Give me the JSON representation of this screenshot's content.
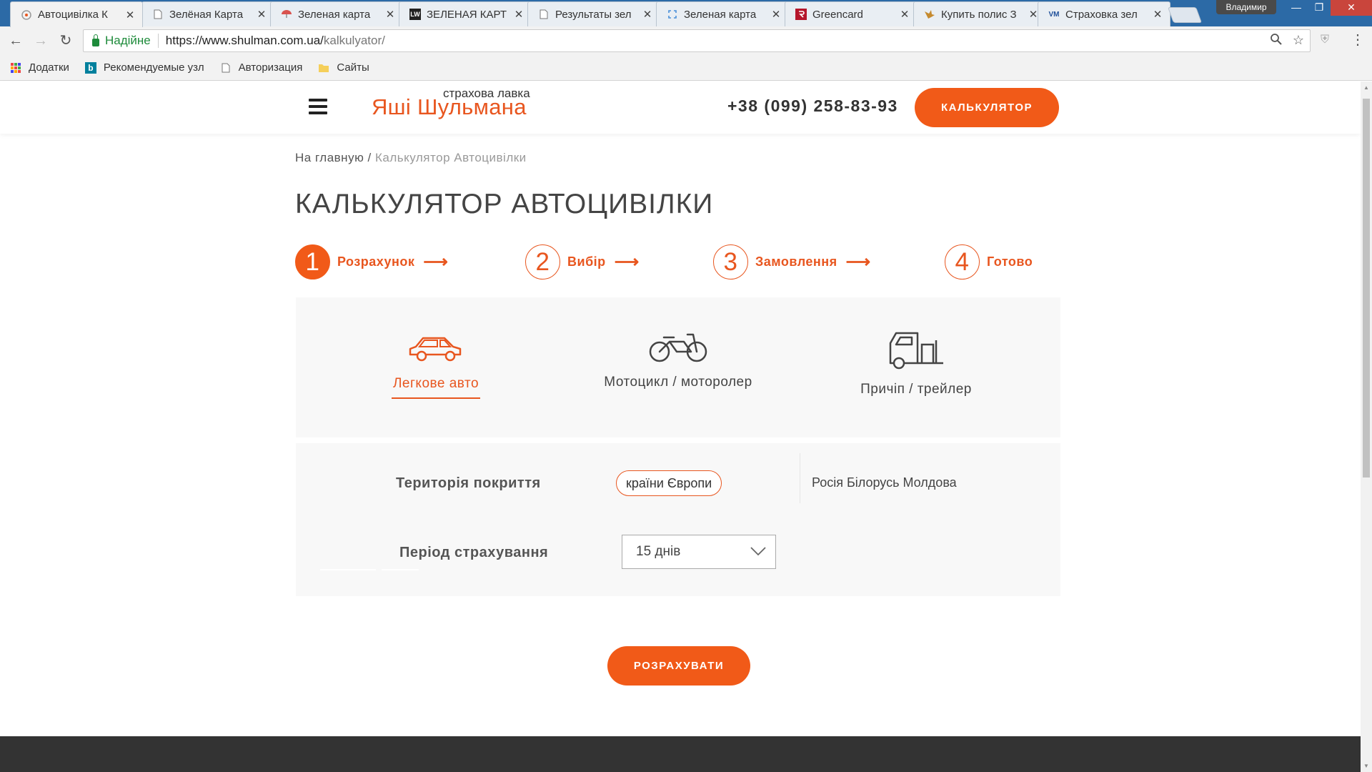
{
  "browser": {
    "tabs": [
      {
        "title": "Автоцивілка К",
        "icon": "shulman-favicon",
        "active": true
      },
      {
        "title": "Зелёная Карта",
        "icon": "page-icon",
        "active": false
      },
      {
        "title": "Зеленая карта",
        "icon": "umbrella-icon",
        "active": false
      },
      {
        "title": "ЗЕЛЕНАЯ КАРТ",
        "icon": "lw-icon",
        "favicon_text": "LW",
        "active": false
      },
      {
        "title": "Результаты зел",
        "icon": "page-icon",
        "active": false
      },
      {
        "title": "Зеленая карта",
        "icon": "loading-icon",
        "active": false
      },
      {
        "title": "Greencard",
        "icon": "greencard-icon",
        "active": false
      },
      {
        "title": "Купить полис З",
        "icon": "bird-icon",
        "active": false
      },
      {
        "title": "Страховка зел",
        "icon": "vm-icon",
        "favicon_text": "VM",
        "active": false
      }
    ],
    "profile_name": "Владимир",
    "security_label": "Надійне",
    "url_host": "https://www.shulman.com.ua/",
    "url_path": "kalkulyator/",
    "bookmarks": [
      {
        "label": "Додатки",
        "icon": "apps-icon"
      },
      {
        "label": "Рекомендуемые узл",
        "icon": "bing-icon"
      },
      {
        "label": "Авторизация",
        "icon": "page-icon"
      },
      {
        "label": "Сайты",
        "icon": "folder-icon"
      }
    ]
  },
  "header": {
    "logo": "Яші Шульмана",
    "logo_sub": "страхова лавка",
    "phone": "+38 (099) 258-83-93",
    "cta": "КАЛЬКУЛЯТОР"
  },
  "breadcrumb": {
    "home": "На главную",
    "separator": " / ",
    "current": "Калькулятор Автоцивілки"
  },
  "title": "КАЛЬКУЛЯТОР АВТОЦИВІЛКИ",
  "steps": [
    {
      "num": "1",
      "label": "Розрахунок",
      "active": true
    },
    {
      "num": "2",
      "label": "Вибір",
      "active": false
    },
    {
      "num": "3",
      "label": "Замовлення",
      "active": false
    },
    {
      "num": "4",
      "label": "Готово",
      "active": false
    }
  ],
  "vehicles": [
    {
      "label": "Легкове авто",
      "icon": "car-icon",
      "selected": true
    },
    {
      "label": "Мотоцикл / моторолер",
      "icon": "motorcycle-icon",
      "selected": false
    },
    {
      "label": "Причіп / трейлер",
      "icon": "trailer-icon",
      "selected": false
    }
  ],
  "territory": {
    "label": "Територія покриття",
    "selected": "країни Європи",
    "alternative": "Росія Білорусь Молдова"
  },
  "period": {
    "label": "Період страхування",
    "value": "15 днів"
  },
  "submit": "РОЗРАХУВАТИ",
  "colors": {
    "accent": "#f15a18",
    "accent_text": "#e8561f",
    "panel_bg": "#f8f8f8",
    "footer_bg": "#333333"
  }
}
